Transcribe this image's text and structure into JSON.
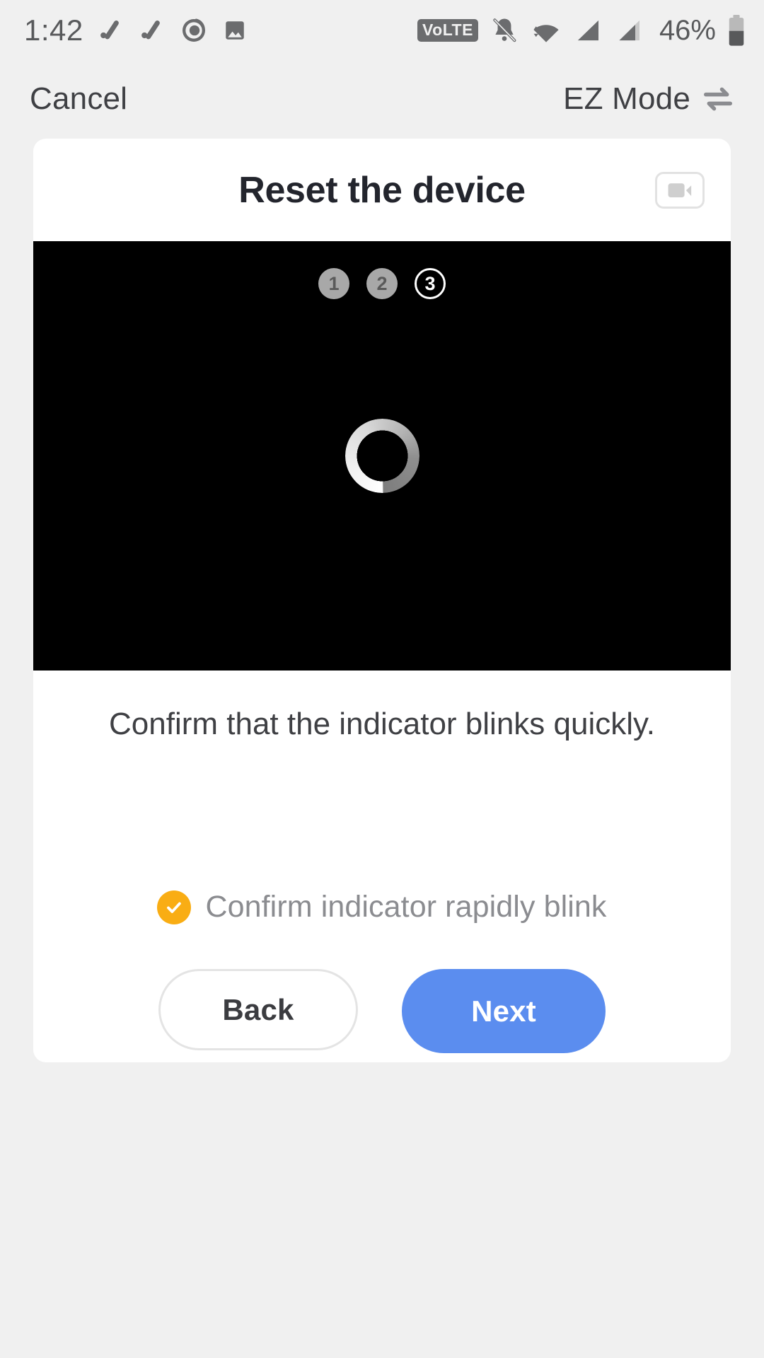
{
  "status_bar": {
    "time": "1:42",
    "battery_percent": "46%",
    "volte_label": "VoLTE",
    "icons": [
      "edit-pencil-icon",
      "edit-pencil-icon",
      "screen-record-icon",
      "image-icon",
      "volte-icon",
      "notifications-muted-icon",
      "wifi-icon",
      "cellular-signal-icon",
      "cellular-signal-2-icon",
      "battery-icon"
    ]
  },
  "header": {
    "cancel_label": "Cancel",
    "mode_label": "EZ Mode",
    "mode_switch_icon": "swap-arrows-icon"
  },
  "card": {
    "title": "Reset the device",
    "video_icon": "video-camera-icon",
    "steps": [
      {
        "number": "1",
        "state": "done"
      },
      {
        "number": "2",
        "state": "done"
      },
      {
        "number": "3",
        "state": "active"
      }
    ],
    "spinner_icon": "loading-spinner-icon",
    "instruction": "Confirm that the indicator blinks quickly.",
    "confirm": {
      "checked": true,
      "check_icon": "check-circle-icon",
      "label": "Confirm indicator rapidly blink"
    },
    "buttons": {
      "back_label": "Back",
      "next_label": "Next"
    }
  },
  "colors": {
    "page_background": "#f0f0f0",
    "card_background": "#ffffff",
    "media_background": "#000000",
    "primary_blue": "#5b8def",
    "check_amber": "#f9ad14",
    "text_dark": "#3f4044",
    "text_muted": "#8b8c90",
    "title_dark": "#23252d",
    "status_icon_gray": "#6b6c6e"
  }
}
